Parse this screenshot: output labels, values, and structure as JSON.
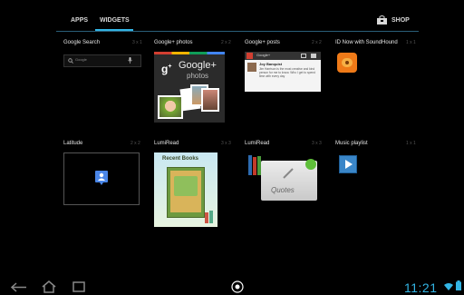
{
  "tabs": [
    {
      "label": "APPS",
      "active": false
    },
    {
      "label": "WIDGETS",
      "active": true
    }
  ],
  "shop": {
    "label": "SHOP",
    "icon": "shop-bag-icon"
  },
  "widgets": [
    {
      "title": "Google Search",
      "size": "3 x 1",
      "search_hint": "Google"
    },
    {
      "title": "Google+ photos",
      "size": "2 x 2",
      "brand": "Google+",
      "sub": "photos"
    },
    {
      "title": "Google+ posts",
      "size": "2 x 2",
      "header": "Google+",
      "author": "Joy Banquist",
      "snippet": "Jim Harrison is the most creative and kind person for me to know. Who I get to spend time with every day"
    },
    {
      "title": "ID Now with SoundHound",
      "size": "1 x 1"
    },
    {
      "title": "Latitude",
      "size": "2 x 2"
    },
    {
      "title": "LumiRead",
      "size": "3 x 3",
      "banner": "Recent Books"
    },
    {
      "title": "LumiRead",
      "size": "3 x 3",
      "banner": "Quotes"
    },
    {
      "title": "Music playlist",
      "size": "1 x 1"
    }
  ],
  "status": {
    "time": "11:21"
  },
  "colors": {
    "accent": "#33b5e5",
    "background": "#000000"
  }
}
